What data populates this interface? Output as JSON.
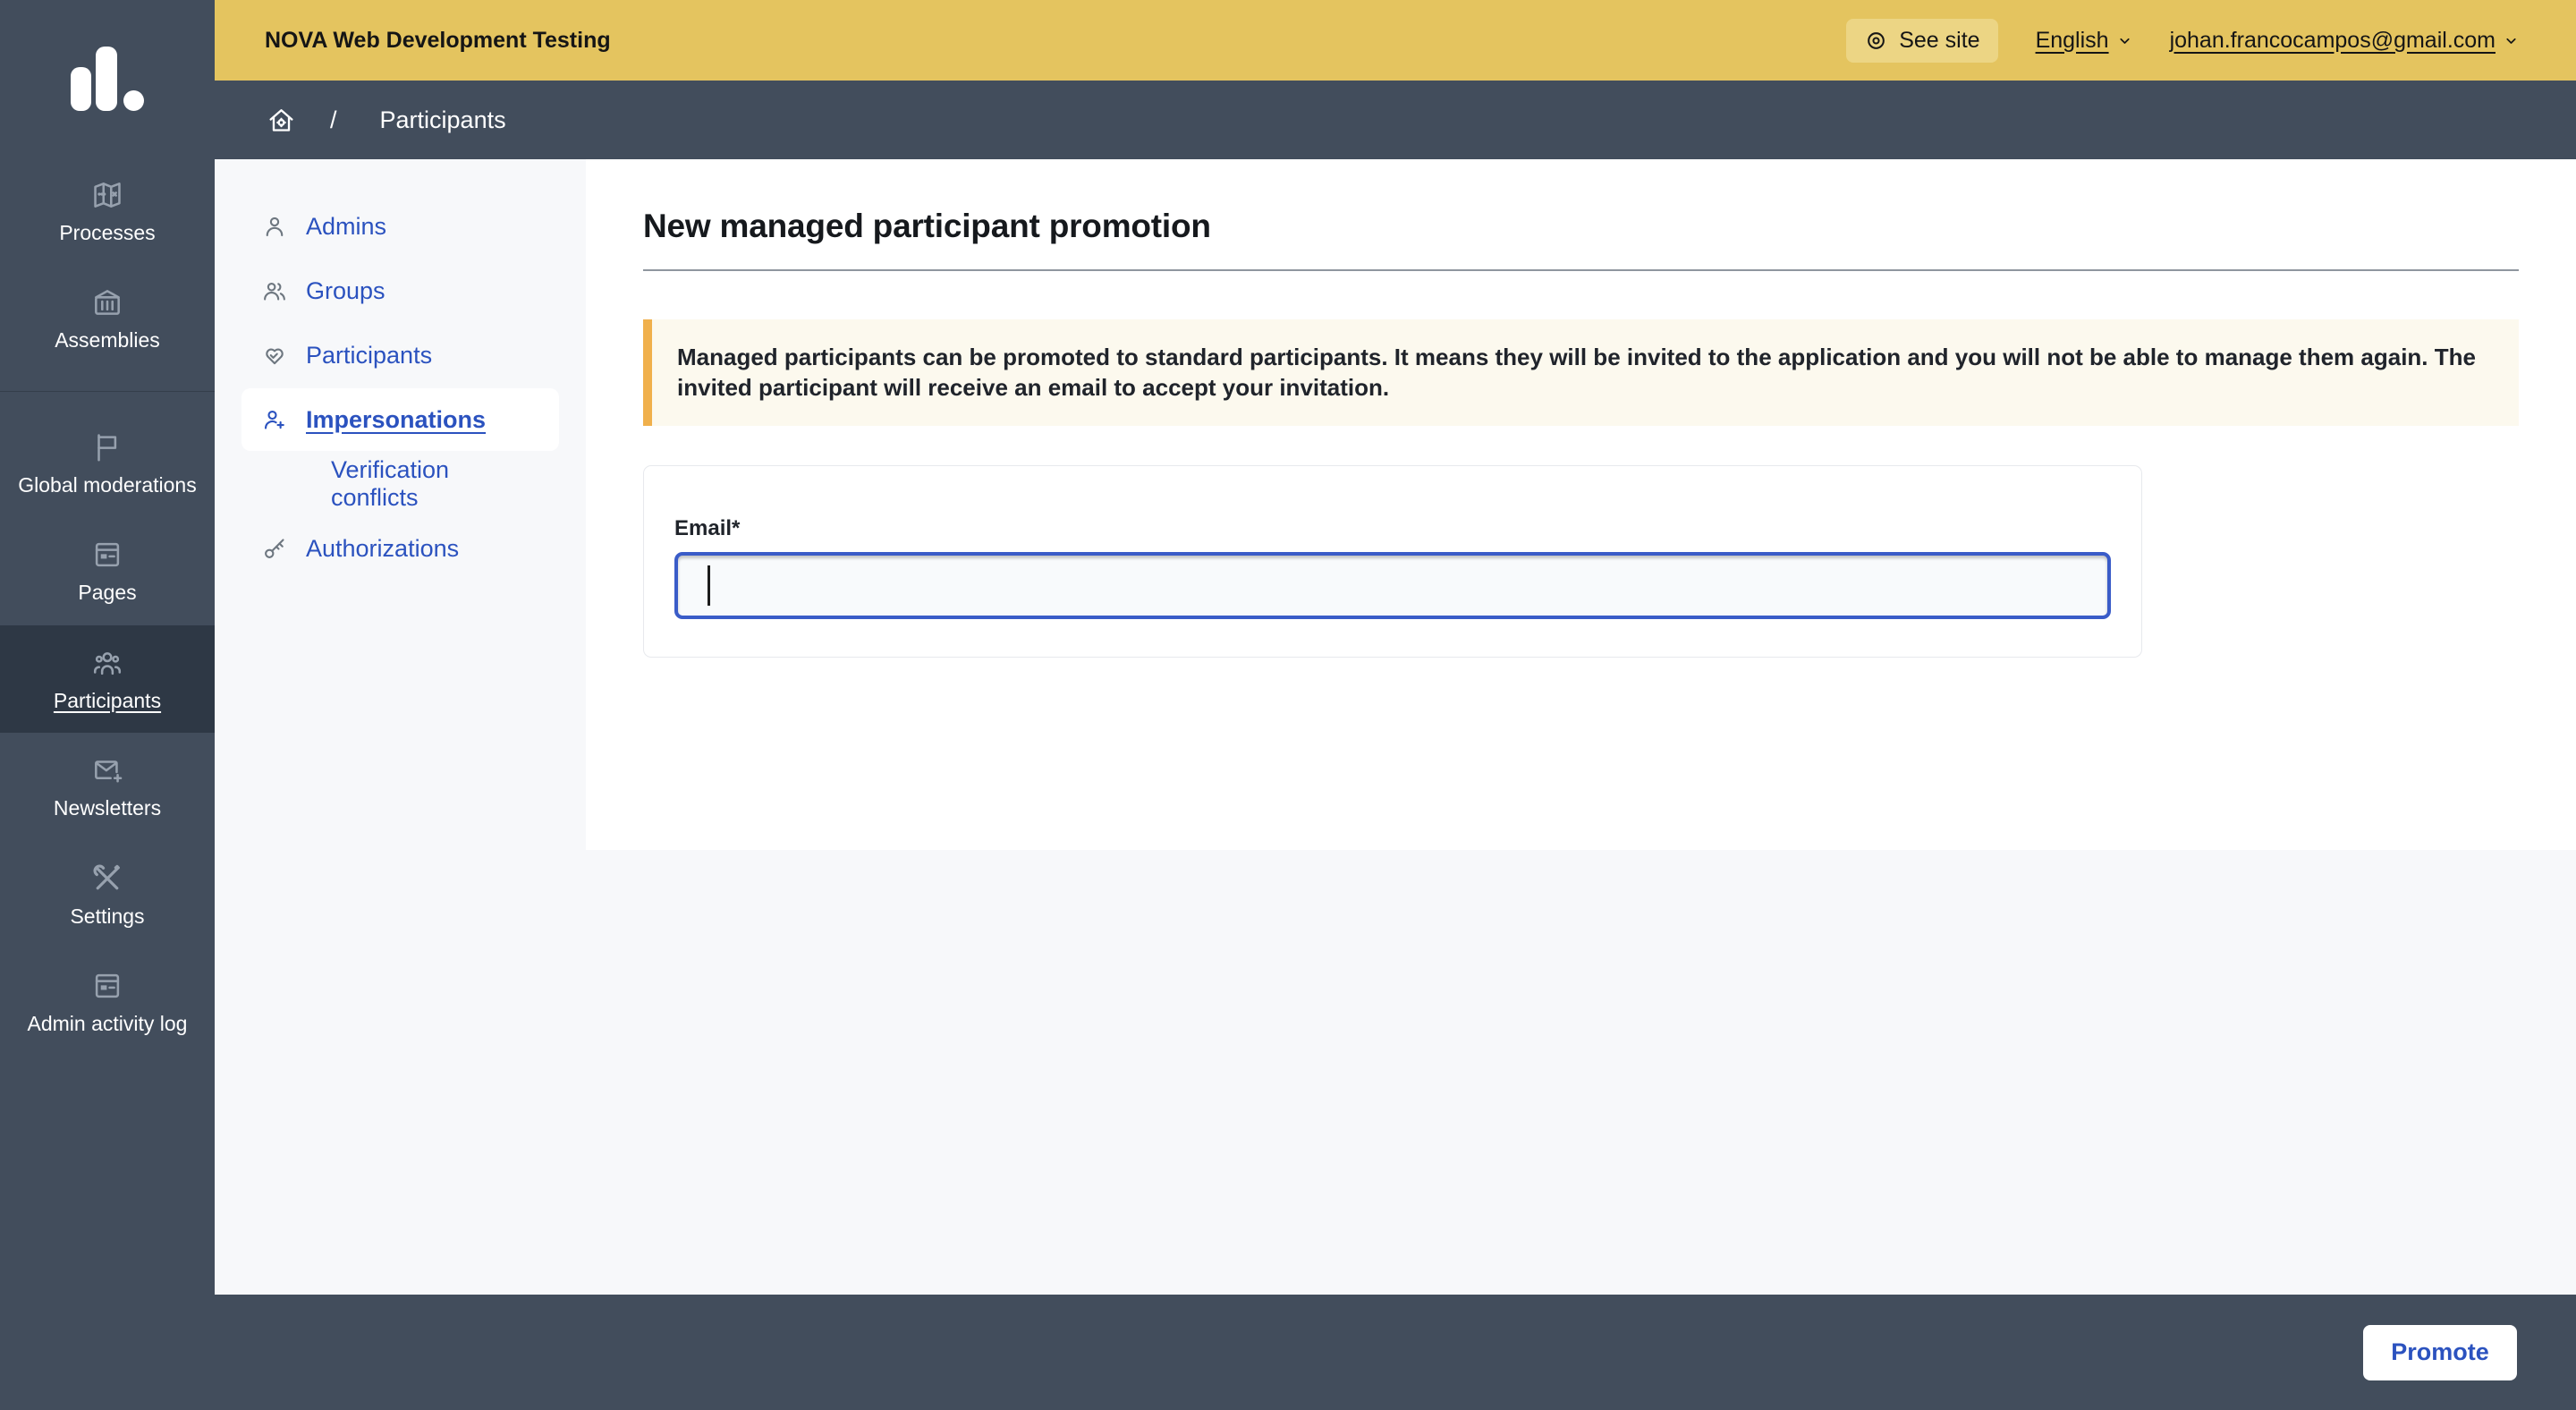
{
  "topbar": {
    "title": "NOVA Web Development Testing",
    "see_site_label": "See site",
    "language_label": "English",
    "account_email": "johan.francocampos@gmail.com"
  },
  "breadcrumb": {
    "separator": "/",
    "current": "Participants"
  },
  "sidebar": {
    "items": [
      {
        "label": "Processes"
      },
      {
        "label": "Assemblies"
      },
      {
        "label": "Global moderations"
      },
      {
        "label": "Pages"
      },
      {
        "label": "Participants",
        "selected": true
      },
      {
        "label": "Newsletters"
      },
      {
        "label": "Settings"
      },
      {
        "label": "Admin activity log"
      }
    ]
  },
  "subnav": {
    "items": [
      {
        "label": "Admins"
      },
      {
        "label": "Groups"
      },
      {
        "label": "Participants"
      },
      {
        "label": "Impersonations",
        "selected": true
      },
      {
        "label": "Verification conflicts",
        "subitem": true
      },
      {
        "label": "Authorizations"
      }
    ]
  },
  "content": {
    "heading": "New managed participant promotion",
    "notice": "Managed participants can be promoted to standard participants. It means they will be invited to the application and you will not be able to manage them again. The invited participant will receive an email to accept your invitation.",
    "form": {
      "email_label": "Email*",
      "email_value": ""
    }
  },
  "footer": {
    "promote_label": "Promote"
  },
  "colors": {
    "topbar_yellow": "#e4c45f",
    "topbar_pill": "#ecd584",
    "slate": "#424d5c",
    "slate_selected": "#2e3845",
    "link_blue": "#2b52bf",
    "page_bg": "#f7f8fa",
    "panel_white": "#ffffff",
    "notice_bg": "#fcf9ee",
    "notice_border": "#f0b04c",
    "input_border": "#3a5cc8",
    "input_bg": "#f8fafc",
    "heading_text": "#16191d",
    "sidebar_icon": "#97a1ae",
    "subnav_icon": "#6e7780",
    "hr_gray": "#8f969f",
    "card_border": "#e7e9ed",
    "topbar_text": "#151515"
  }
}
